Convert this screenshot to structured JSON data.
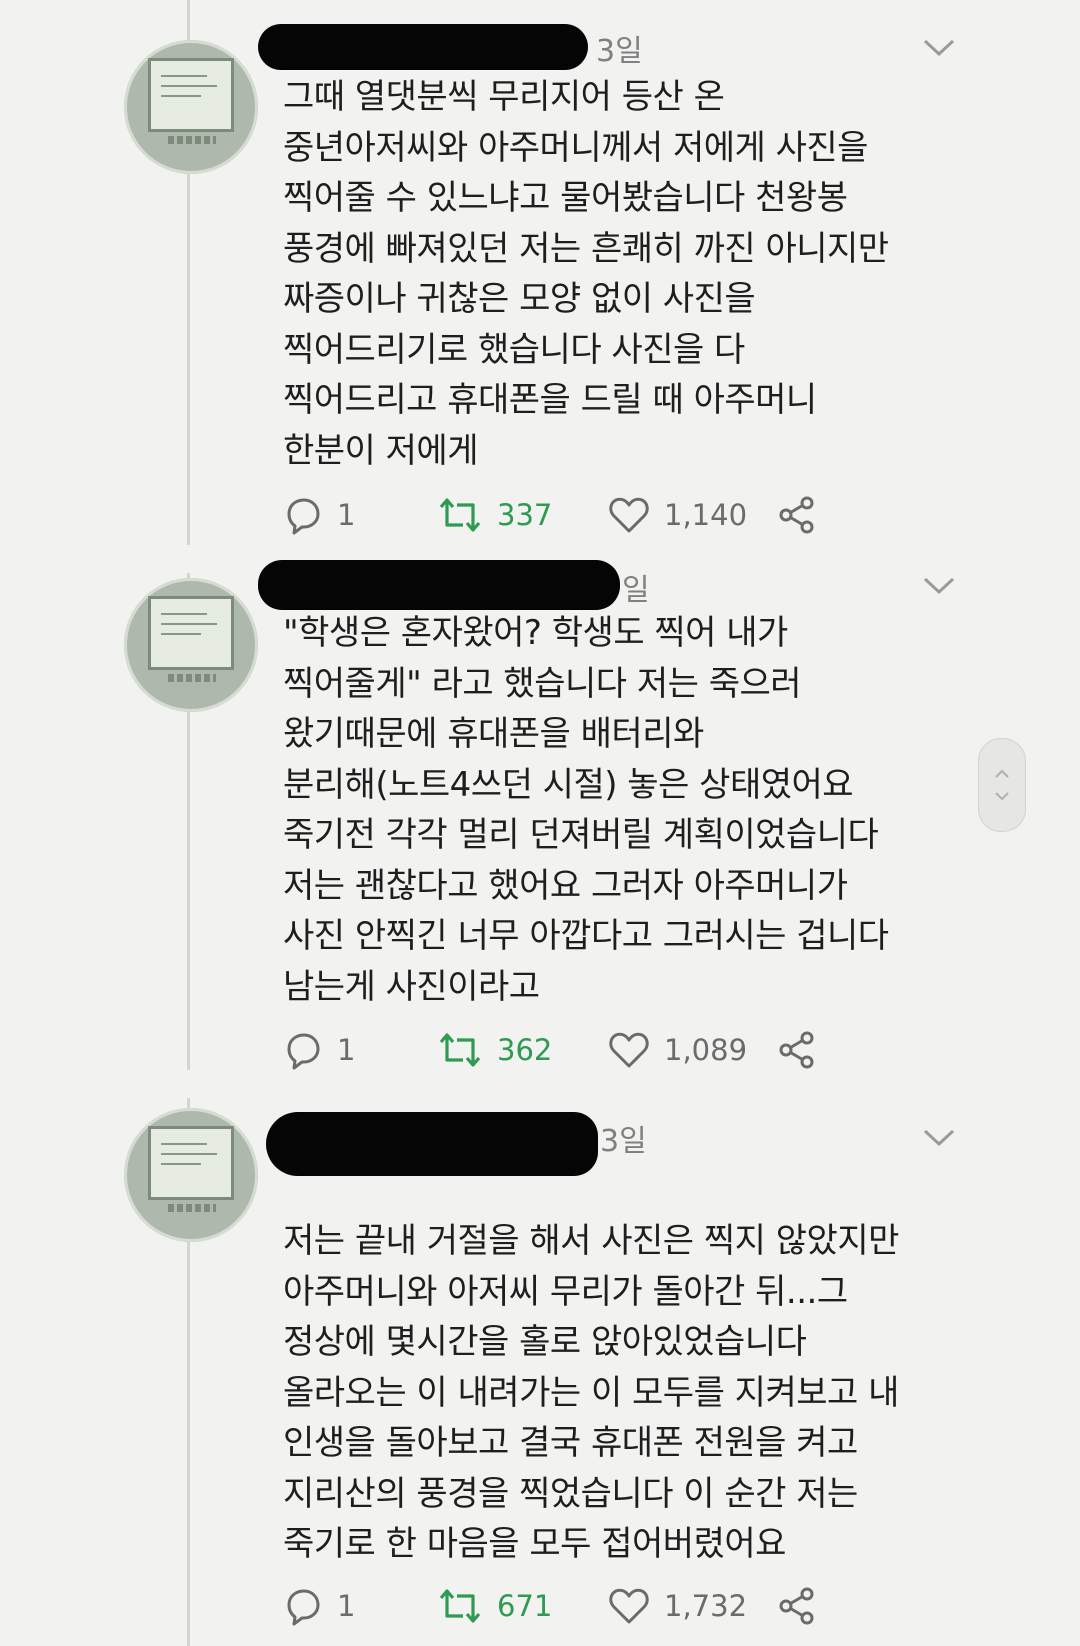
{
  "tweets": [
    {
      "time": "3일",
      "lines": [
        "그때 열댓분씩 무리지어 등산 온",
        "중년아저씨와 아주머니께서 저에게 사진을",
        "찍어줄 수 있느냐고 물어봤습니다 천왕봉",
        "풍경에 빠져있던 저는 흔쾌히 까진 아니지만",
        "짜증이나 귀찮은 모양 없이 사진을",
        "찍어드리기로 했습니다 사진을 다",
        "찍어드리고 휴대폰을 드릴 때 아주머니",
        "한분이 저에게"
      ],
      "replies": "1",
      "retweets": "337",
      "likes": "1,140"
    },
    {
      "time": "일",
      "lines": [
        "\"학생은 혼자왔어? 학생도 찍어 내가",
        "찍어줄게\" 라고 했습니다 저는 죽으러",
        "왔기때문에 휴대폰을 배터리와",
        "분리해(노트4쓰던 시절) 놓은 상태였어요",
        "죽기전 각각 멀리 던져버릴 계획이었습니다",
        "저는 괜찮다고 했어요 그러자 아주머니가",
        "사진 안찍긴 너무 아깝다고 그러시는 겁니다",
        "남는게 사진이라고"
      ],
      "replies": "1",
      "retweets": "362",
      "likes": "1,089"
    },
    {
      "time": "3일",
      "lines": [
        "저는 끝내 거절을 해서 사진은 찍지 않았지만",
        "아주머니와 아저씨 무리가 돌아간 뒤...그",
        "정상에 몇시간을 홀로 앉아있었습니다",
        "올라오는 이 내려가는 이 모두를 지켜보고 내",
        "인생을 돌아보고 결국 휴대폰 전원을 켜고",
        "지리산의 풍경을 찍었습니다 이 순간 저는",
        "죽기로 한 마음을 모두 접어버렸어요"
      ],
      "replies": "1",
      "retweets": "671",
      "likes": "1,732"
    }
  ],
  "icons": {
    "reply": "reply-icon",
    "retweet": "retweet-icon",
    "like": "heart-icon",
    "share": "share-icon",
    "menu": "chevron-down-icon"
  },
  "colors": {
    "background": "#f2f2f0",
    "retweet": "#2e9a52",
    "muted": "#6b6b6b",
    "redaction": "#050505"
  }
}
